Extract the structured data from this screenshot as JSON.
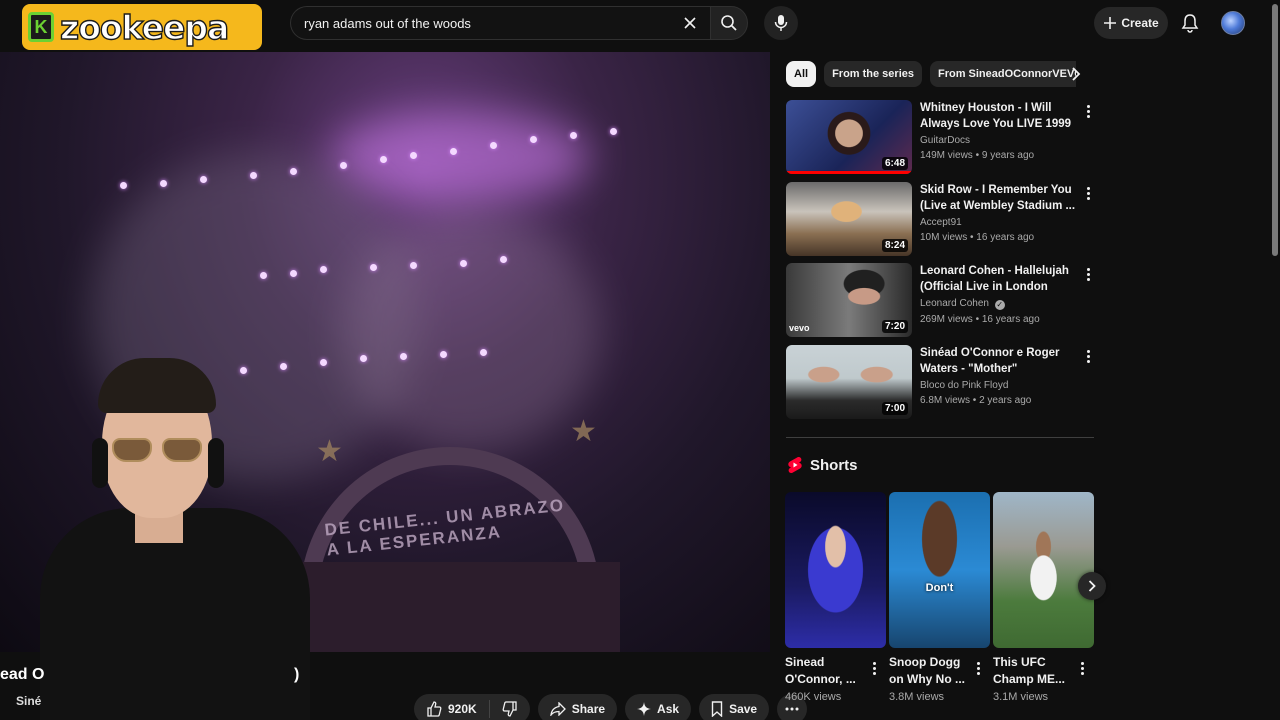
{
  "header": {
    "logo_letter": "K",
    "logo_text": "zookeepa",
    "search_value": "ryan adams out of the woods",
    "create_label": "Create",
    "icons": [
      "clear-icon",
      "search-icon",
      "mic-icon",
      "plus-icon",
      "bell-icon"
    ]
  },
  "video": {
    "title_fragment_left": "ead O",
    "title_fragment_right": ")",
    "channel_fragment": "Siné",
    "banner_text": "DE CHILE... UN ABRAZO A LA ESPERANZA"
  },
  "actions": {
    "like_count": "920K",
    "share_label": "Share",
    "ask_label": "Ask",
    "save_label": "Save"
  },
  "chips": [
    {
      "label": "All",
      "active": true
    },
    {
      "label": "From the series",
      "active": false
    },
    {
      "label": "From SineadOConnorVEVO",
      "active": false
    }
  ],
  "related": [
    {
      "title": "Whitney Houston - I Will Always Love You LIVE 1999 Best ...",
      "channel": "GuitarDocs",
      "meta": "149M views • 9 years ago",
      "duration": "6:48",
      "verified": false
    },
    {
      "title": "Skid Row - I Remember You (Live at Wembley Stadium ...",
      "channel": "Accept91",
      "meta": "10M views • 16 years ago",
      "duration": "8:24",
      "verified": false
    },
    {
      "title": "Leonard Cohen - Hallelujah (Official Live in London 2008)",
      "channel": "Leonard Cohen",
      "meta": "269M views • 16 years ago",
      "duration": "7:20",
      "verified": true,
      "badge": "vevo"
    },
    {
      "title": "Sinéad O'Connor e Roger Waters - \"Mother\"",
      "channel": "Bloco do Pink Floyd",
      "meta": "6.8M views • 2 years ago",
      "duration": "7:00",
      "verified": false
    }
  ],
  "shorts": {
    "heading": "Shorts",
    "items": [
      {
        "title": "Sinead O'Connor, ...",
        "views": "460K views",
        "overlay": ""
      },
      {
        "title": "Snoop Dogg on Why No ...",
        "views": "3.8M views",
        "overlay": "Don't"
      },
      {
        "title": "This UFC Champ ME...",
        "views": "3.1M views",
        "overlay": ""
      }
    ]
  },
  "colors": {
    "background": "#0f0f0f",
    "chip_bg": "#272727",
    "logo_bg": "#f5b81c",
    "logo_green": "#6bd132",
    "progress_red": "#ff0000"
  }
}
